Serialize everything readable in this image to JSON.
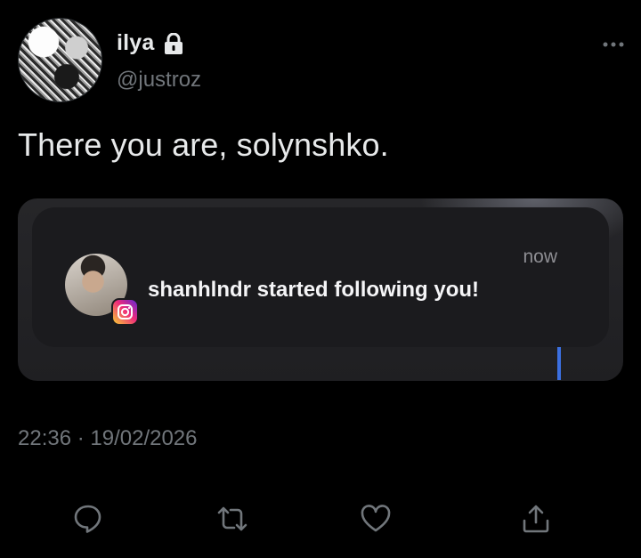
{
  "author": {
    "name": "ilya",
    "handle": "@justroz",
    "locked_icon": "lock-icon"
  },
  "more_icon": "more-horizontal-icon",
  "tweet": {
    "text": "There you are, solynshko.",
    "timestamp": "22:36 · 19/02/2026"
  },
  "notification": {
    "app_icon": "instagram-icon",
    "message": "shanhlndr started following you!",
    "time": "now"
  },
  "actions": [
    {
      "icon": "reply-icon"
    },
    {
      "icon": "retweet-icon"
    },
    {
      "icon": "like-icon"
    },
    {
      "icon": "share-icon"
    }
  ],
  "colors": {
    "background": "#000000",
    "primary_text": "#e7e9ea",
    "secondary_text": "#71767b"
  }
}
